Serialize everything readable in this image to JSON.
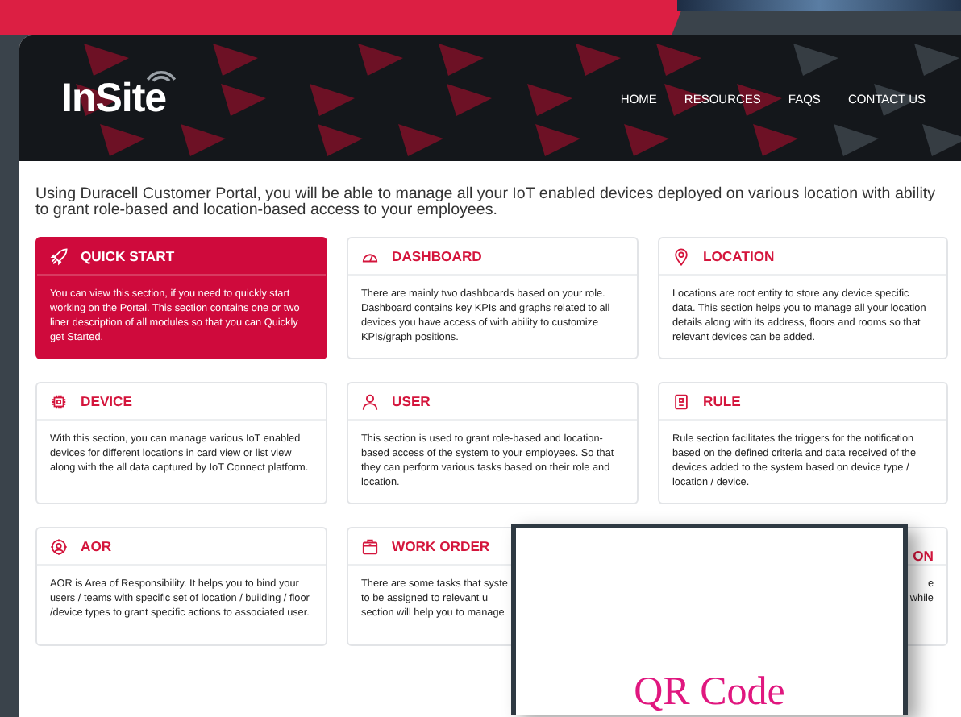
{
  "header": {
    "logo": "InSite",
    "nav": [
      "HOME",
      "RESOURCES",
      "FAQS",
      "CONTACT US"
    ]
  },
  "intro": "Using Duracell Customer Portal, you will be able to manage all your IoT enabled devices deployed on various location with ability to grant role-based and location-based access to your employees.",
  "cards": [
    {
      "kind": "featured",
      "title": "QUICK START",
      "text": "You can view this section, if you need to quickly start working on the Portal. This section contains one or two liner description of all modules so that you can Quickly get Started."
    },
    {
      "kind": "plain",
      "title": "DASHBOARD",
      "text": "There are mainly two dashboards based on your role. Dashboard contains key KPIs and graphs related to all devices you have access of with ability to customize KPIs/graph positions."
    },
    {
      "kind": "plain",
      "title": "LOCATION",
      "text": "Locations are root entity to store any device specific data. This section helps you to manage all your location details along with its address, floors and rooms so that relevant devices can be added."
    },
    {
      "kind": "plain",
      "title": "DEVICE",
      "text": "With this section, you can manage various IoT enabled devices for different locations in card view or list view along with the all data captured by IoT Connect platform."
    },
    {
      "kind": "plain",
      "title": "USER",
      "text": "This section is used to grant role-based and location-based access of the system to your employees. So that they can perform various tasks based on their role and location."
    },
    {
      "kind": "plain",
      "title": "RULE",
      "text": "Rule section facilitates the triggers for the notification based on the defined criteria and data received of the devices added to the system based on device type / location / device."
    },
    {
      "kind": "plain",
      "title": "AOR",
      "text": "AOR is Area of Responsibility. It helps you to bind your users / teams with specific set of location / building / floor /device types to grant specific actions to associated user."
    },
    {
      "kind": "covered-left",
      "title": "WORK ORDER",
      "lines": [
        "There are some tasks that syste",
        "to be assigned to relevant u",
        "section will help you to manage"
      ]
    },
    {
      "kind": "covered-right",
      "title": "ON",
      "lines": [
        "e",
        "while"
      ]
    }
  ],
  "overlay": {
    "title": "QR Code"
  }
}
